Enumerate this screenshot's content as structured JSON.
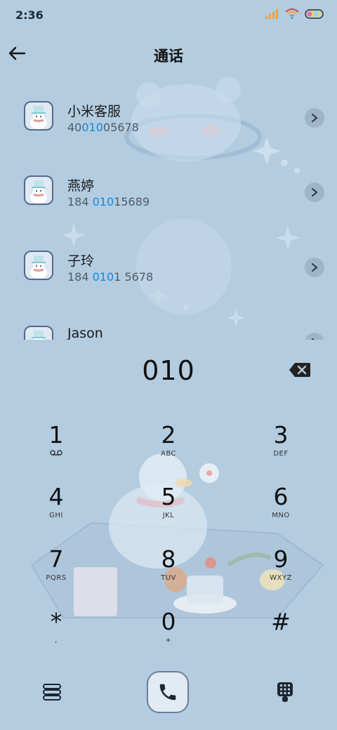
{
  "status_bar": {
    "time": "2:36",
    "signal_icon": "signal-bars-icon",
    "wifi_icon": "wifi-icon",
    "battery_icon": "battery-icon"
  },
  "header": {
    "title": "通话",
    "back_icon": "arrow-left-icon"
  },
  "contacts": [
    {
      "name": "小米客服",
      "number_parts": [
        "40",
        "010",
        "05678"
      ]
    },
    {
      "name": "燕婷",
      "number_parts": [
        "184 ",
        "010",
        "15689"
      ]
    },
    {
      "name": "子玲",
      "number_parts": [
        "184 ",
        "010",
        "1 5678"
      ]
    },
    {
      "name": "Jason",
      "number_parts": [
        "",
        "",
        ""
      ]
    }
  ],
  "highlight_color": "#1688dc",
  "input": {
    "value": "010",
    "backspace_icon": "backspace-icon"
  },
  "keypad": [
    {
      "digit": "1",
      "sub": "voicemail-icon"
    },
    {
      "digit": "2",
      "sub": "ABC"
    },
    {
      "digit": "3",
      "sub": "DEF"
    },
    {
      "digit": "4",
      "sub": "GHI"
    },
    {
      "digit": "5",
      "sub": "JKL"
    },
    {
      "digit": "6",
      "sub": "MNO"
    },
    {
      "digit": "7",
      "sub": "PQRS"
    },
    {
      "digit": "8",
      "sub": "TUV"
    },
    {
      "digit": "9",
      "sub": "WXYZ"
    },
    {
      "digit": "*",
      "sub": ","
    },
    {
      "digit": "0",
      "sub": "+"
    },
    {
      "digit": "#",
      "sub": ""
    }
  ],
  "bottom_bar": {
    "menu_icon": "menu-icon",
    "call_icon": "phone-icon",
    "dialpad_icon": "dialpad-icon"
  }
}
